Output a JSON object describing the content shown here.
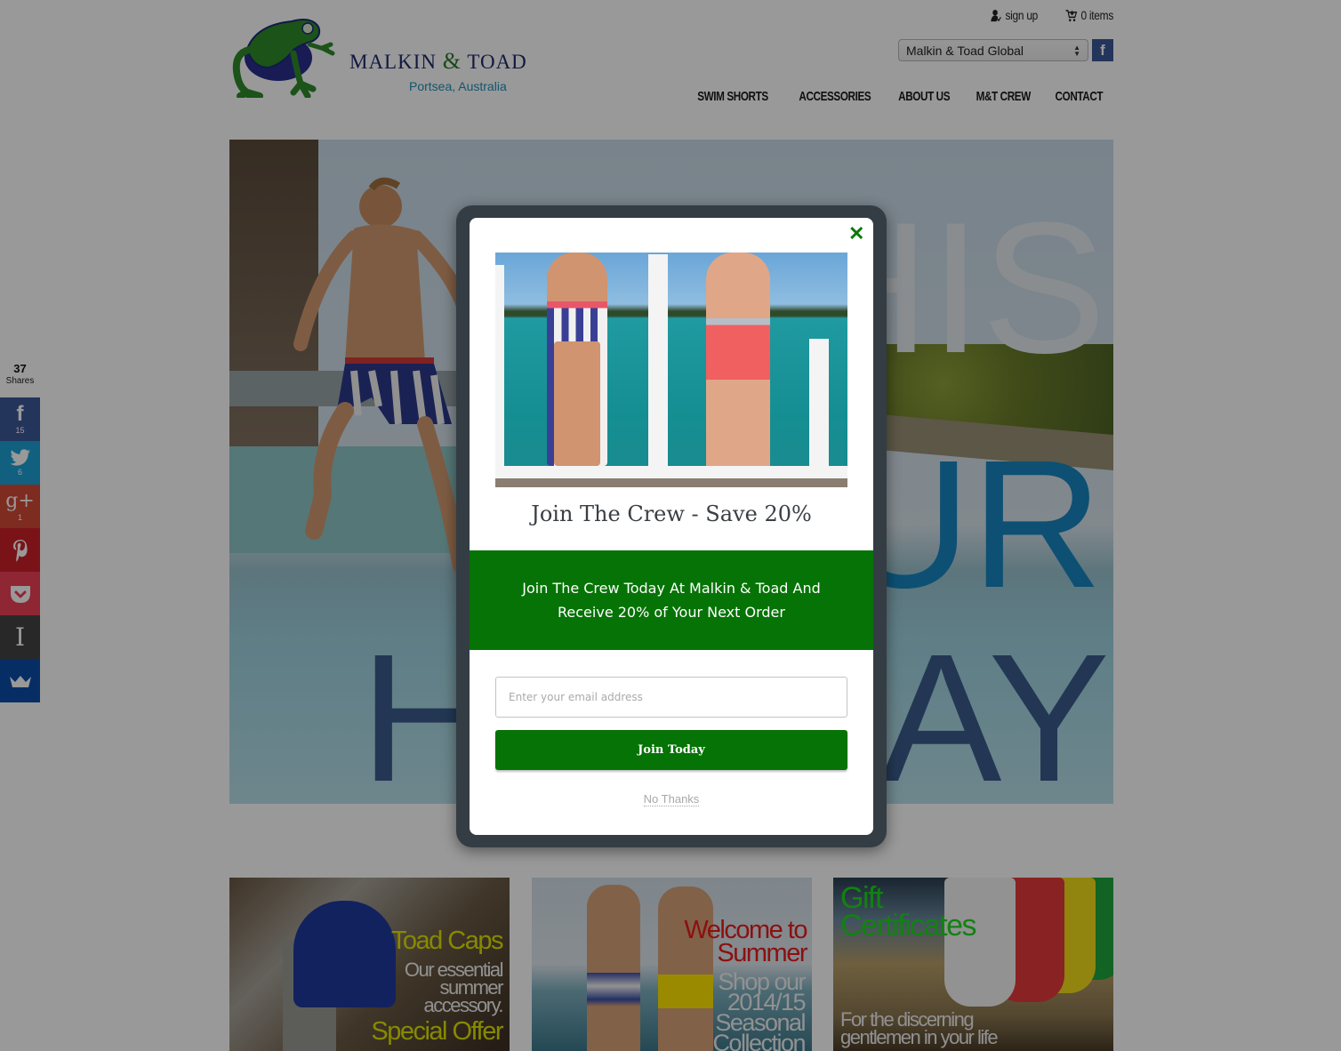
{
  "brand": {
    "name_first": "Malkin",
    "name_amp": "&",
    "name_last": "Toad",
    "location": "Portsea, Australia",
    "colors": {
      "frog_green": "#2f8a2a",
      "navy": "#1f2a6b",
      "teal": "#1e8fb8"
    }
  },
  "utility": {
    "signup_label": "sign up",
    "signup_icon": "user-add-icon",
    "cart_label": "0 items",
    "cart_icon": "cart-icon"
  },
  "region": {
    "selected": "Malkin & Toad Global",
    "facebook_glyph": "f"
  },
  "nav": {
    "items": [
      {
        "label": "SWIM SHORTS"
      },
      {
        "label": "ACCESSORIES"
      },
      {
        "label": "ABOUT US"
      },
      {
        "label": "M&T CREW"
      },
      {
        "label": "CONTACT"
      }
    ]
  },
  "hero": {
    "word1": "HIS",
    "word2": "UR",
    "word3_left": "H",
    "word3_right": "AY"
  },
  "tiles": [
    {
      "title": "Toad Caps",
      "subtitle": "Our essential summer accessory.",
      "cta": "Special Offer"
    },
    {
      "title": "Welcome to Summer",
      "subtitle": "Shop our 2014/15 Seasonal Collection"
    },
    {
      "title": "Gift Certificates",
      "subtitle": "For the discerning gentlemen in your life"
    }
  ],
  "share": {
    "total": "37",
    "total_label": "Shares",
    "buttons": [
      {
        "network": "facebook",
        "icon": "facebook-icon",
        "glyph": "f",
        "count": "15",
        "color": "#3b5998"
      },
      {
        "network": "twitter",
        "icon": "twitter-icon",
        "glyph": "🐦",
        "count": "6",
        "color": "#1da1d6"
      },
      {
        "network": "google-plus",
        "icon": "google-plus-icon",
        "glyph": "g+",
        "count": "1",
        "color": "#d34836"
      },
      {
        "network": "pinterest",
        "icon": "pinterest-icon",
        "glyph": "P",
        "count": "",
        "color": "#cb2027"
      },
      {
        "network": "pocket",
        "icon": "pocket-icon",
        "glyph": "⌄",
        "count": "",
        "color": "#ee4056"
      },
      {
        "network": "instapaper",
        "icon": "instapaper-icon",
        "glyph": "I",
        "count": "",
        "color": "#444444"
      },
      {
        "network": "crown",
        "icon": "crown-icon",
        "glyph": "♛",
        "count": "",
        "color": "#0a4ea8"
      }
    ]
  },
  "popup": {
    "close_glyph": "✕",
    "title": "Join The Crew - Save 20%",
    "band_text": "Join The Crew Today At Malkin & Toad And Receive 20% of Your Next Order",
    "email_placeholder": "Enter your email address",
    "email_value": "",
    "submit_label": "Join Today",
    "decline_label": "No Thanks",
    "accent_color": "#067306",
    "frame_color": "#343d44"
  }
}
